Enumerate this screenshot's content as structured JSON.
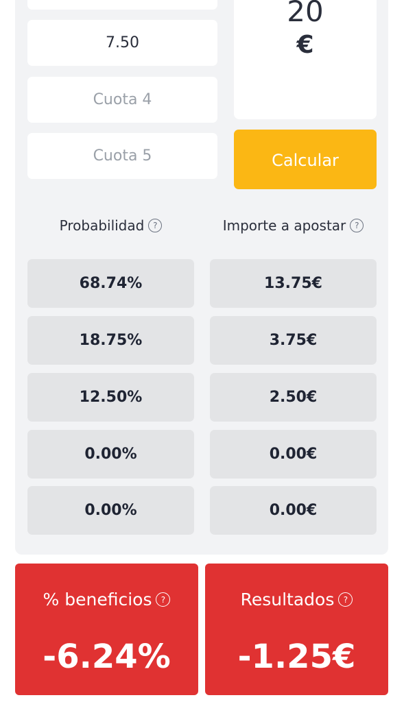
{
  "odds": {
    "cuota3_value": "7.50",
    "cuota4_placeholder": "Cuota 4",
    "cuota5_placeholder": "Cuota 5"
  },
  "stake": {
    "value": "20",
    "currency": "€"
  },
  "calculate_label": "Calcular",
  "columns": {
    "probability": "Probabilidad",
    "amount": "Importe a apostar"
  },
  "rows": [
    {
      "probability": "68.74%",
      "amount": "13.75€"
    },
    {
      "probability": "18.75%",
      "amount": "3.75€"
    },
    {
      "probability": "12.50%",
      "amount": "2.50€"
    },
    {
      "probability": "0.00%",
      "amount": "0.00€"
    },
    {
      "probability": "0.00%",
      "amount": "0.00€"
    }
  ],
  "results": {
    "profit_title": "% beneficios",
    "profit_value": "-6.24%",
    "result_title": "Resultados",
    "result_value": "-1.25€"
  },
  "help_glyph": "?",
  "colors": {
    "accent": "#fbb714",
    "result_bg": "#e03232",
    "panel_bg": "#f2f3f5",
    "cell_bg": "#e3e4e6"
  },
  "icons": {
    "help": "question-circle-icon"
  }
}
